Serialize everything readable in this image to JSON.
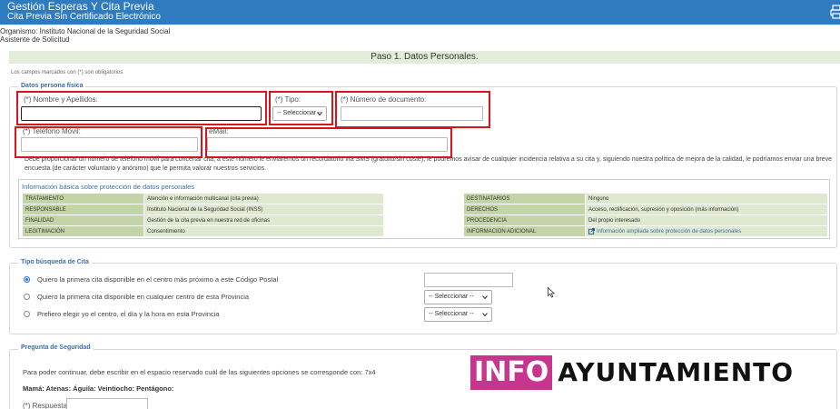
{
  "header": {
    "title": "Gestión Esperas Y Cita Previa",
    "subtitle": "Cita Previa Sin Certificado Electrónico",
    "print_icon": "printer-icon"
  },
  "organismo": {
    "label": "Organismo:",
    "value": "Instituto Nacional de la Seguridad Social",
    "assistant": "Asistente de Solicitud"
  },
  "step": {
    "title": "Paso 1. Datos Personales."
  },
  "mandatory_note": "Los campos marcados con (*) son obligatorios",
  "datos": {
    "legend": "Datos persona física",
    "nombre_label": "(*) Nombre y Apellidos:",
    "nombre_value": "",
    "tipo_label": "(*) Tipo:",
    "tipo_value": "-- Seleccionar --",
    "numdoc_label": "(*) Número de documento:",
    "numdoc_value": "",
    "telefono_label": "(*) Teléfono Móvil:",
    "telefono_value": "",
    "email_label": "eMail:",
    "email_value": "",
    "info_text": "Debe proporcionar un número de teléfono móvil para concertar cita, a este número le enviaremos un recordatorio vía SMS (gratuito/sin coste), le podremos avisar de cualquier incidencia relativa a su cita y, siguiendo nuestra política de mejora de la calidad, le podríamos enviar una breve encuesta (de carácter voluntario y anónimo) que le permita valorar nuestros servicios."
  },
  "lopd": {
    "title": "Información básica sobre protección de datos personales",
    "rows": [
      {
        "k1": "TRATAMIENTO",
        "v1": "Atención e información multicanal (cita previa)",
        "k2": "DESTINATARIOS",
        "v2": "Ninguno"
      },
      {
        "k1": "RESPONSABLE",
        "v1": "Instituto Nacional de la Seguridad Social (INSS)",
        "k2": "DERECHOS",
        "v2": "Acceso, rectificación, supresión y oposición (más información)"
      },
      {
        "k1": "FINALIDAD",
        "v1": "Gestión de la cita previa en nuestra red de oficinas",
        "k2": "PROCEDENCIA",
        "v2": "Del propio interesado"
      },
      {
        "k1": "LEGITIMACIÓN",
        "v1": "Consentimiento",
        "k2": "INFORMACION ADICIONAL",
        "v2": "Información ampliada sobre protección de datos personales"
      }
    ]
  },
  "busqueda": {
    "legend": "Tipo búsqueda de Cita",
    "options": [
      {
        "label": "Quiero la primera cita disponible en el centro más próximo a este Código Postal",
        "selected": true,
        "control_value": ""
      },
      {
        "label": "Quiero la primera cita disponible en cualquier centro de esta Provincia",
        "selected": false,
        "control_value": "-- Seleccionar --"
      },
      {
        "label": "Prefiero elegir yo el centro, el día y la hora en esta Provincia",
        "selected": false,
        "control_value": "-- Seleccionar --"
      }
    ]
  },
  "seguridad": {
    "legend": "Pregunta de Seguridad",
    "question": "Para poder continuar, debe escribir en el espacio reservado cuál de las siguientes opciones se corresponde con: 7x4",
    "options_text": "Mamá: Atenas: Águila: Veintiocho: Pentágono:",
    "answer_label": "(*) Respuesta:",
    "answer_value": ""
  },
  "watermark": {
    "part1": "INFO",
    "part2": "AYUNTAMIENTO"
  },
  "colors": {
    "header_blue": "#2e7bbf",
    "step_green": "#e1ecd9",
    "highlight_red": "#d8141d",
    "legend_blue": "#3b6fa9",
    "watermark_magenta": "#c8358f"
  }
}
